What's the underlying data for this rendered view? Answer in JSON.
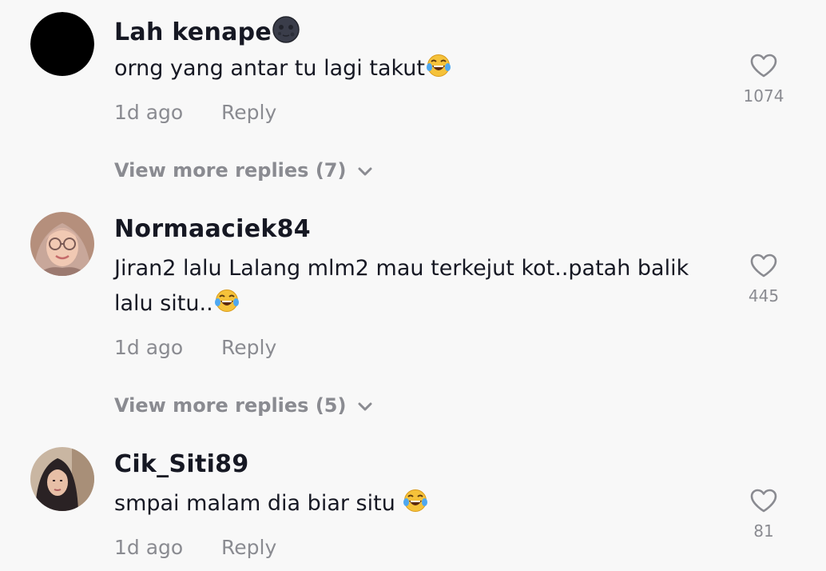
{
  "comments": [
    {
      "username": "Lah kenape",
      "username_icon": "new-moon-face-emoji",
      "text": "orng yang antar tu lagi takut",
      "text_icon": "tears-of-joy-emoji",
      "time": "1d ago",
      "reply_label": "Reply",
      "likes": "1074",
      "view_more": "View more replies (7)",
      "avatar": "black-circle-avatar"
    },
    {
      "username": "Normaaciek84",
      "text": "Jiran2 lalu Lalang mlm2 mau terkejut kot..patah balik lalu situ..",
      "text_icon": "tears-of-joy-emoji",
      "time": "1d ago",
      "reply_label": "Reply",
      "likes": "445",
      "view_more": "View more replies (5)",
      "avatar": "woman-glasses-hijab-avatar"
    },
    {
      "username": "Cik_Siti89",
      "text": "smpai malam dia biar situ ",
      "text_icon": "tears-of-joy-emoji",
      "time": "1d ago",
      "reply_label": "Reply",
      "likes": "81",
      "avatar": "woman-hijab-avatar"
    }
  ],
  "colors": {
    "background": "#f8f8f8",
    "text": "#161823",
    "muted": "#8a8b91"
  }
}
